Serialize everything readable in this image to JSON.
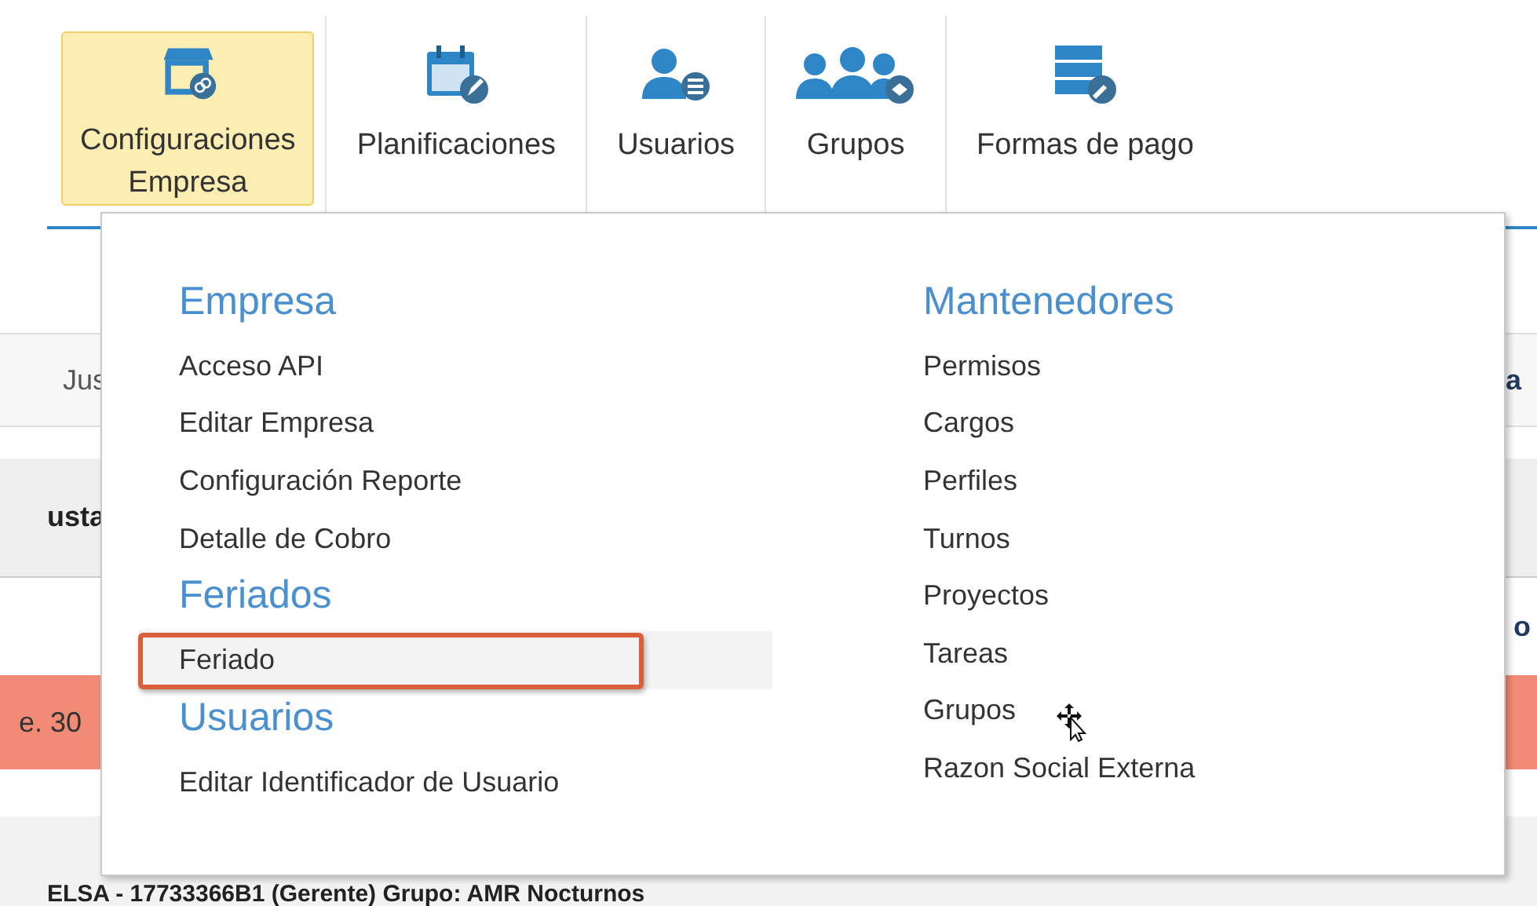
{
  "nav": [
    {
      "label": "Configuraciones\nEmpresa",
      "kind": "store",
      "selected": true
    },
    {
      "label": "Planificaciones",
      "kind": "calendar",
      "selected": false
    },
    {
      "label": "Usuarios",
      "kind": "user",
      "selected": false
    },
    {
      "label": "Grupos",
      "kind": "group",
      "selected": false
    },
    {
      "label": "Formas de pago",
      "kind": "server",
      "selected": false
    }
  ],
  "background": {
    "row_1": {
      "left": "Jus",
      "right": "a"
    },
    "row_2": {
      "left": "usta"
    },
    "row_3": {
      "right": "o"
    },
    "row_4": {
      "left": "e. 30"
    },
    "row_5": {
      "left": "ELSA - 17733366B1 (Gerente) Grupo: AMR Nocturnos"
    }
  },
  "menu": {
    "columns": [
      {
        "sections": [
          {
            "heading": "Empresa",
            "items": [
              {
                "label": "Acceso API",
                "selected": false
              },
              {
                "label": "Editar Empresa",
                "selected": false
              },
              {
                "label": "Configuración Reporte",
                "selected": false
              },
              {
                "label": "Detalle de Cobro",
                "selected": false
              }
            ]
          },
          {
            "heading": "Feriados",
            "items": [
              {
                "label": "Feriado",
                "selected": true
              }
            ]
          },
          {
            "heading": "Usuarios",
            "items": [
              {
                "label": "Editar Identificador de Usuario",
                "selected": false
              }
            ]
          }
        ]
      },
      {
        "sections": [
          {
            "heading": "Mantenedores",
            "items": [
              {
                "label": "Permisos",
                "selected": false
              },
              {
                "label": "Cargos",
                "selected": false
              },
              {
                "label": "Perfiles",
                "selected": false
              },
              {
                "label": "Turnos",
                "selected": false
              },
              {
                "label": "Proyectos",
                "selected": false
              },
              {
                "label": "Tareas",
                "selected": false
              },
              {
                "label": "Grupos",
                "selected": false
              },
              {
                "label": "Razon Social Externa",
                "selected": false
              }
            ]
          }
        ]
      }
    ]
  }
}
